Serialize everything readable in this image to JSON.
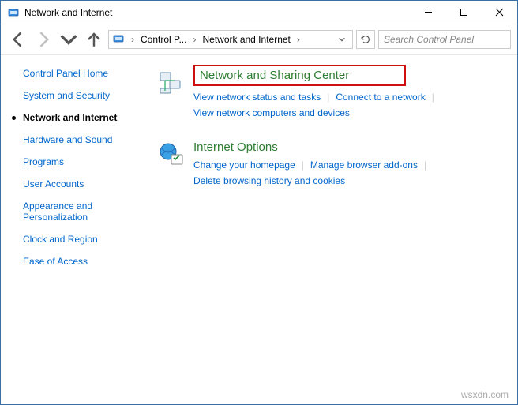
{
  "window": {
    "title": "Network and Internet"
  },
  "toolbar": {
    "breadcrumbs": [
      "Control P...",
      "Network and Internet"
    ]
  },
  "search": {
    "placeholder": "Search Control Panel"
  },
  "sidebar": {
    "items": [
      {
        "label": "Control Panel Home",
        "current": false
      },
      {
        "label": "System and Security",
        "current": false
      },
      {
        "label": "Network and Internet",
        "current": true
      },
      {
        "label": "Hardware and Sound",
        "current": false
      },
      {
        "label": "Programs",
        "current": false
      },
      {
        "label": "User Accounts",
        "current": false
      },
      {
        "label": "Appearance and Personalization",
        "current": false
      },
      {
        "label": "Clock and Region",
        "current": false
      },
      {
        "label": "Ease of Access",
        "current": false
      }
    ]
  },
  "content": {
    "sections": [
      {
        "title": "Network and Sharing Center",
        "highlighted": true,
        "tasks": [
          "View network status and tasks",
          "Connect to a network",
          "View network computers and devices"
        ]
      },
      {
        "title": "Internet Options",
        "highlighted": false,
        "tasks": [
          "Change your homepage",
          "Manage browser add-ons",
          "Delete browsing history and cookies"
        ]
      }
    ]
  },
  "watermark": "wsxdn.com"
}
